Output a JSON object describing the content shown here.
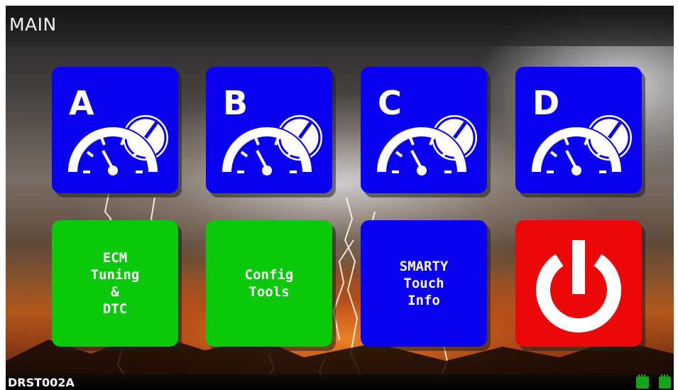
{
  "header": {
    "title": "MAIN"
  },
  "tiles": {
    "a": {
      "letter": "A",
      "icon": "gauge-icon"
    },
    "b": {
      "letter": "B",
      "icon": "gauge-icon"
    },
    "c": {
      "letter": "C",
      "icon": "gauge-icon"
    },
    "d": {
      "letter": "D",
      "icon": "gauge-icon"
    },
    "ecm": {
      "label": "ECM\nTuning\n&\nDTC"
    },
    "config": {
      "label": "Config\nTools"
    },
    "info": {
      "label": "SMARTY\nTouch\nInfo"
    },
    "power": {
      "icon": "power-icon"
    }
  },
  "footer": {
    "device_id": "DRST002A",
    "status_icons": [
      "memory-card-icon",
      "memory-card-icon"
    ]
  },
  "colors": {
    "tile_blue": "#0a00f0",
    "tile_green": "#0ac80a",
    "tile_red": "#ec0808",
    "status_green": "#13a51c"
  }
}
